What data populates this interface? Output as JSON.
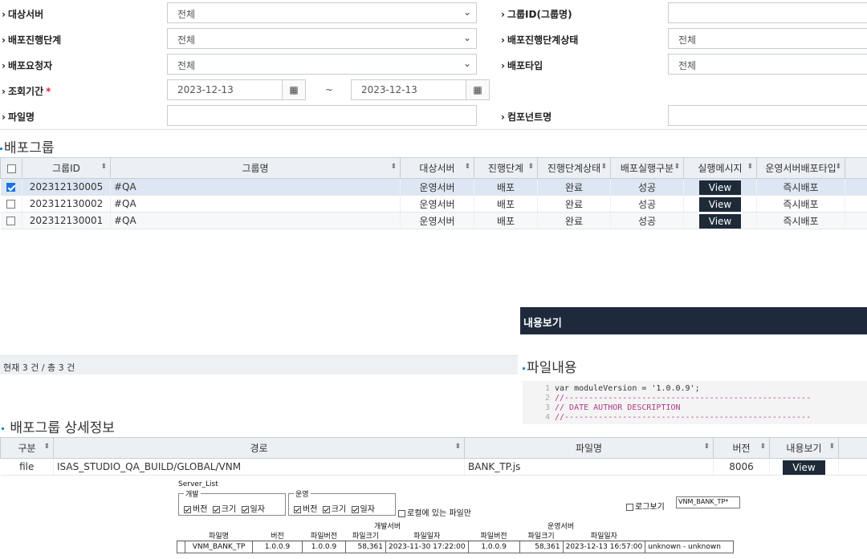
{
  "search": {
    "target_server": {
      "label": "대상서버",
      "value": "전체"
    },
    "group_id": {
      "label": "그룹ID(그룹명)",
      "value": ""
    },
    "deploy_stage": {
      "label": "배포진행단계",
      "value": "전체"
    },
    "deploy_stage_status": {
      "label": "배포진행단계상태",
      "value": "전체"
    },
    "requester": {
      "label": "배포요청자",
      "value": "전체"
    },
    "deploy_type": {
      "label": "배포타입",
      "value": "전체"
    },
    "period": {
      "label": "조회기간",
      "required_mark": "*",
      "from": "2023-12-13",
      "to": "2023-12-13",
      "separator": "~"
    },
    "file_name": {
      "label": "파일명",
      "value": ""
    },
    "component_name": {
      "label": "컴포넌트명",
      "value": ""
    }
  },
  "deploy_group": {
    "title": "배포그룹",
    "columns": [
      "그룹ID",
      "그룹명",
      "대상서버",
      "진행단계",
      "진행단계상태",
      "배포실행구분",
      "실행메시지",
      "운영서버배포타입"
    ],
    "rows": [
      {
        "checked": true,
        "group_id": "202312130005",
        "group_name": "#QA",
        "server": "운영서버",
        "stage": "배포",
        "status": "완료",
        "exec": "성공",
        "message": "View",
        "type": "즉시배포"
      },
      {
        "checked": false,
        "group_id": "202312130002",
        "group_name": "#QA",
        "server": "운영서버",
        "stage": "배포",
        "status": "완료",
        "exec": "성공",
        "message": "View",
        "type": "즉시배포"
      },
      {
        "checked": false,
        "group_id": "202312130001",
        "group_name": "#QA",
        "server": "운영서버",
        "stage": "배포",
        "status": "완료",
        "exec": "성공",
        "message": "View",
        "type": "즉시배포"
      }
    ],
    "status_text": "현재 3 건 / 총 3 건"
  },
  "content_view": {
    "header": "내용보기",
    "section_title": "파일내용",
    "lines": [
      {
        "no": "1",
        "text": "var moduleVersion = '1.0.0.9';"
      },
      {
        "no": "2",
        "text": "//---------------------------------------------------"
      },
      {
        "no": "3",
        "text": "//    DATE        AUTHOR    DESCRIPTION"
      },
      {
        "no": "4",
        "text": "//---------------------------------------------------"
      }
    ]
  },
  "detail": {
    "title": "배포그룹 상세정보",
    "columns": [
      "구분",
      "경로",
      "파일명",
      "버전",
      "내용보기"
    ],
    "rows": [
      {
        "kind": "file",
        "path": "ISAS_STUDIO_QA_BUILD/GLOBAL/VNM",
        "file": "BANK_TP.js",
        "version": "8006",
        "view": "View"
      }
    ]
  },
  "server_list": {
    "title": "Server_List",
    "dev_group": {
      "label": "개발",
      "opts": [
        "버전",
        "크기",
        "일자"
      ]
    },
    "ops_group": {
      "label": "운영",
      "opts": [
        "버전",
        "크기",
        "일자"
      ]
    },
    "local_only": "로컬에 있는 파일만",
    "log_view": "로그보기",
    "filter_value": "VNM_BANK_TP*",
    "head_top": {
      "dev": "개발서버",
      "ops": "운영서버"
    },
    "head": [
      "파일명",
      "버전",
      "파일버전",
      "파일크기",
      "파일일자",
      "파일버전",
      "파일크기",
      "파일일자"
    ],
    "row": {
      "name": "VNM_BANK_TP",
      "ver": "1.0.0.9",
      "dev_ver": "1.0.0.9",
      "dev_size": "58,361",
      "dev_date": "2023-11-30 17:22:00",
      "ops_ver": "1.0.0.9",
      "ops_size": "58,361",
      "ops_date": "2023-12-13 16:57:00",
      "note": "unknown - unknown"
    }
  }
}
